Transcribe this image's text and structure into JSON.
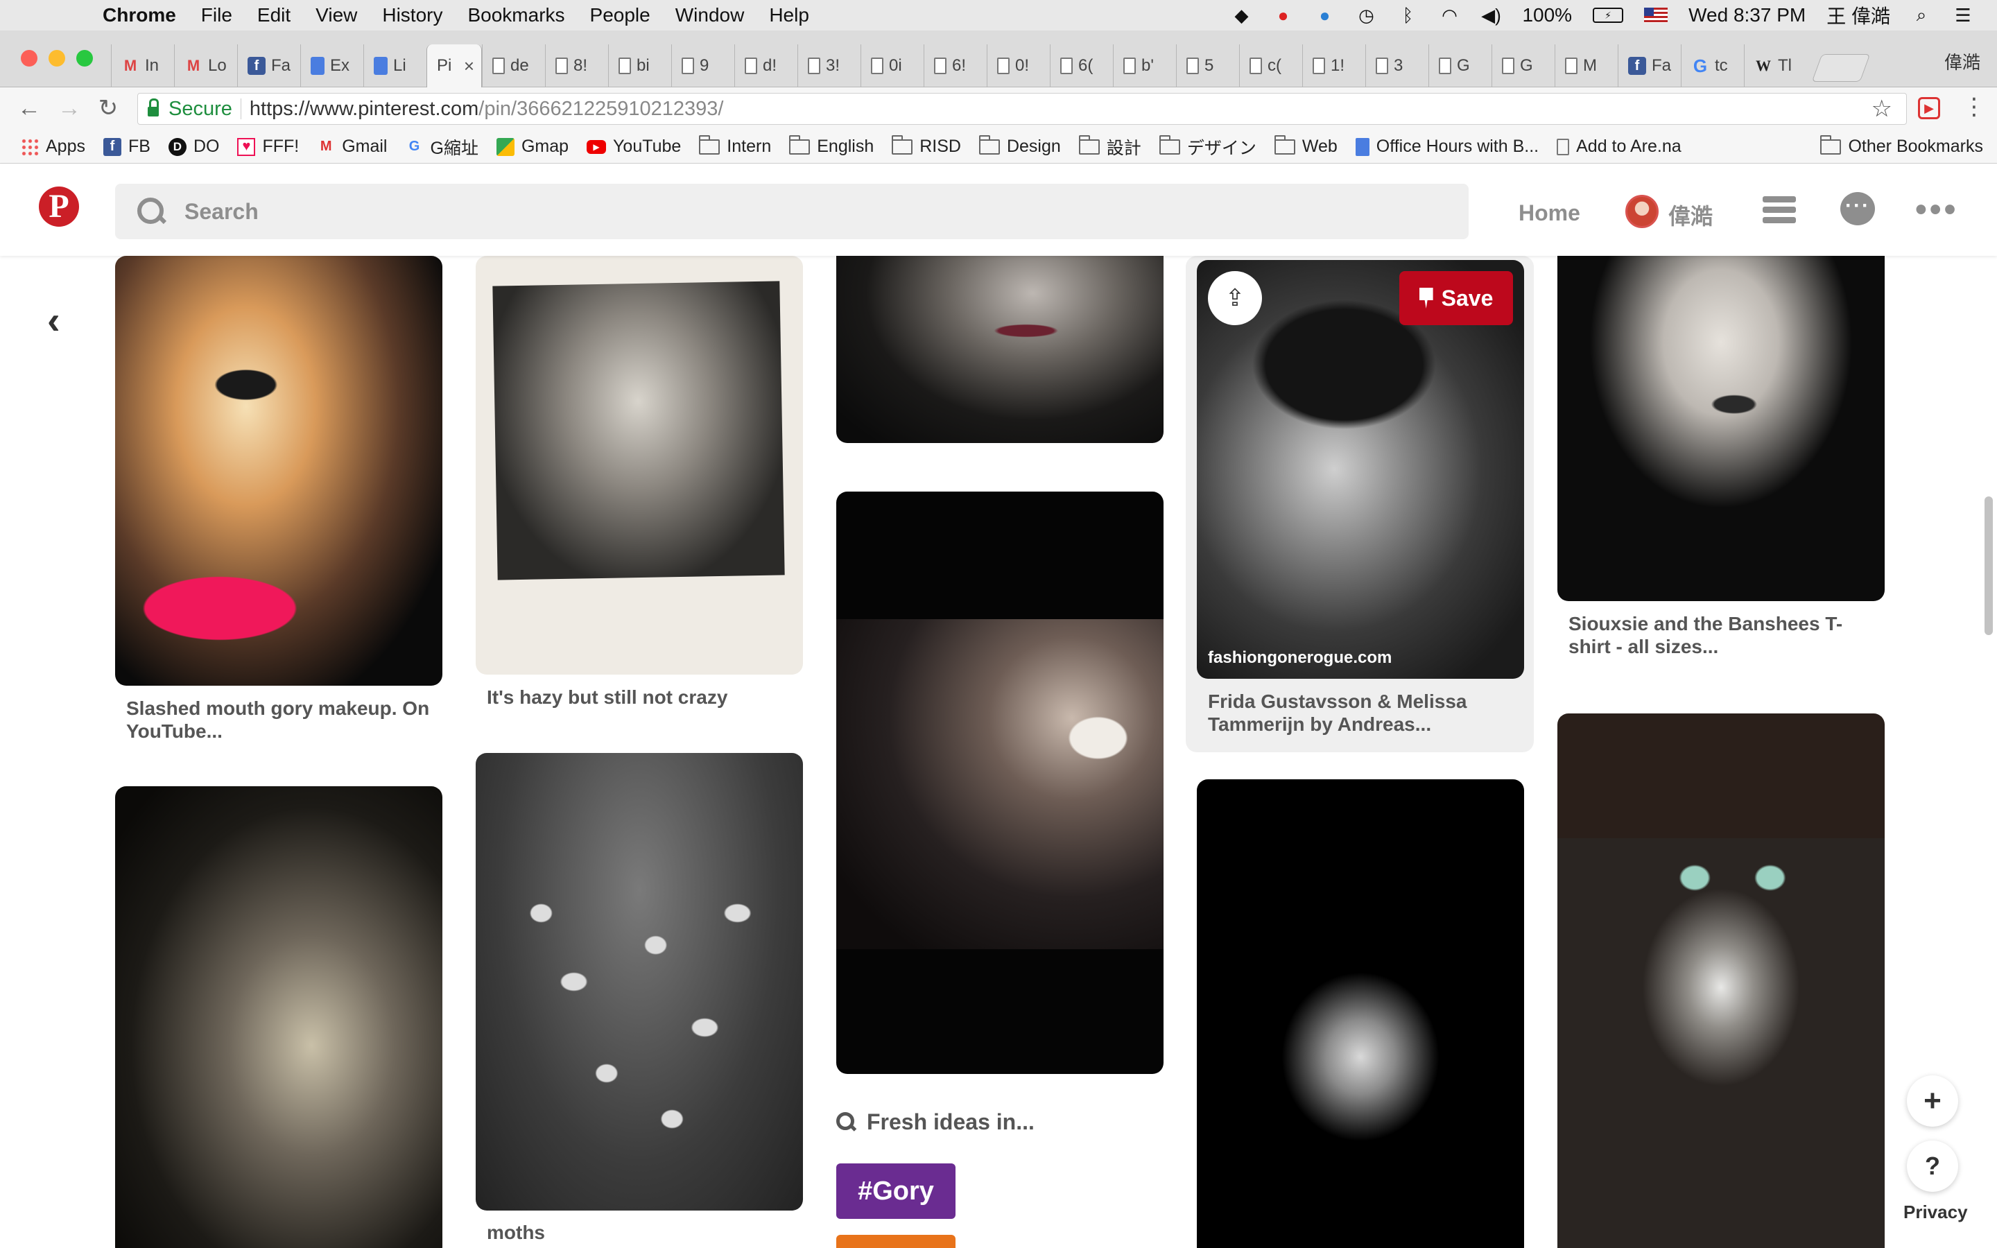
{
  "menubar": {
    "app": "Chrome",
    "items": [
      "File",
      "Edit",
      "View",
      "History",
      "Bookmarks",
      "People",
      "Window",
      "Help"
    ],
    "battery": "100%",
    "clock": "Wed 8:37 PM",
    "user": "王 偉澔"
  },
  "tabs": [
    {
      "icon": "gmail-icon",
      "label": "In"
    },
    {
      "icon": "gmail-icon",
      "label": "Lo"
    },
    {
      "icon": "facebook-icon",
      "label": "Fa"
    },
    {
      "icon": "docs-icon",
      "label": "Ex"
    },
    {
      "icon": "docs-icon",
      "label": "Li"
    },
    {
      "icon": "pinterest-icon",
      "label": "Pi",
      "active": true
    },
    {
      "icon": "page-icon",
      "label": "de"
    },
    {
      "icon": "page-icon",
      "label": "8!"
    },
    {
      "icon": "page-icon",
      "label": "bi"
    },
    {
      "icon": "page-icon",
      "label": "9"
    },
    {
      "icon": "page-icon",
      "label": "d!"
    },
    {
      "icon": "page-icon",
      "label": "3!"
    },
    {
      "icon": "page-icon",
      "label": "0i"
    },
    {
      "icon": "page-icon",
      "label": "6!"
    },
    {
      "icon": "page-icon",
      "label": "0!"
    },
    {
      "icon": "page-icon",
      "label": "6("
    },
    {
      "icon": "page-icon",
      "label": "b'"
    },
    {
      "icon": "page-icon",
      "label": "5"
    },
    {
      "icon": "page-icon",
      "label": "c("
    },
    {
      "icon": "page-icon",
      "label": "1!"
    },
    {
      "icon": "page-icon",
      "label": "3"
    },
    {
      "icon": "page-icon",
      "label": "G"
    },
    {
      "icon": "page-icon",
      "label": "G"
    },
    {
      "icon": "image-icon",
      "label": "M"
    },
    {
      "icon": "facebook-icon",
      "label": "Fa"
    },
    {
      "icon": "google-icon",
      "label": "tc"
    },
    {
      "icon": "wikipedia-icon",
      "label": "Tl"
    }
  ],
  "profile": "偉澔",
  "omnibox": {
    "secure_label": "Secure",
    "url_host": "https://www.pinterest.com",
    "url_path": "/pin/366621225910212393/"
  },
  "bookmarks": [
    {
      "icon": "apps",
      "label": "Apps"
    },
    {
      "icon": "fb",
      "label": "FB"
    },
    {
      "icon": "do",
      "label": "DO"
    },
    {
      "icon": "fff",
      "label": "FFF!"
    },
    {
      "icon": "gmail",
      "label": "Gmail"
    },
    {
      "icon": "google",
      "label": "G縮址"
    },
    {
      "icon": "map",
      "label": "Gmap"
    },
    {
      "icon": "youtube",
      "label": "YouTube"
    },
    {
      "icon": "folder",
      "label": "Intern"
    },
    {
      "icon": "folder",
      "label": "English"
    },
    {
      "icon": "folder",
      "label": "RISD"
    },
    {
      "icon": "folder",
      "label": "Design"
    },
    {
      "icon": "folder",
      "label": "設計"
    },
    {
      "icon": "folder",
      "label": "デザイン"
    },
    {
      "icon": "folder",
      "label": "Web"
    },
    {
      "icon": "doc",
      "label": "Office Hours with B..."
    },
    {
      "icon": "page",
      "label": "Add to Are.na"
    }
  ],
  "other_bookmarks": "Other Bookmarks",
  "pinterest": {
    "search_placeholder": "Search",
    "home": "Home",
    "username": "偉澔",
    "hover_save": "Save",
    "hover_source": "fashiongonerogue.com",
    "fresh_ideas": "Fresh ideas in...",
    "tag": "#Gory",
    "privacy": "Privacy",
    "captions": {
      "c1": "Slashed mouth gory makeup. On YouTube...",
      "c2": "It's hazy but still not crazy",
      "c4": "Frida Gustavsson & Melissa Tammerijn by Andreas...",
      "c5": "Siouxsie and the Banshees T-shirt - all sizes...",
      "c7": "moths"
    }
  }
}
